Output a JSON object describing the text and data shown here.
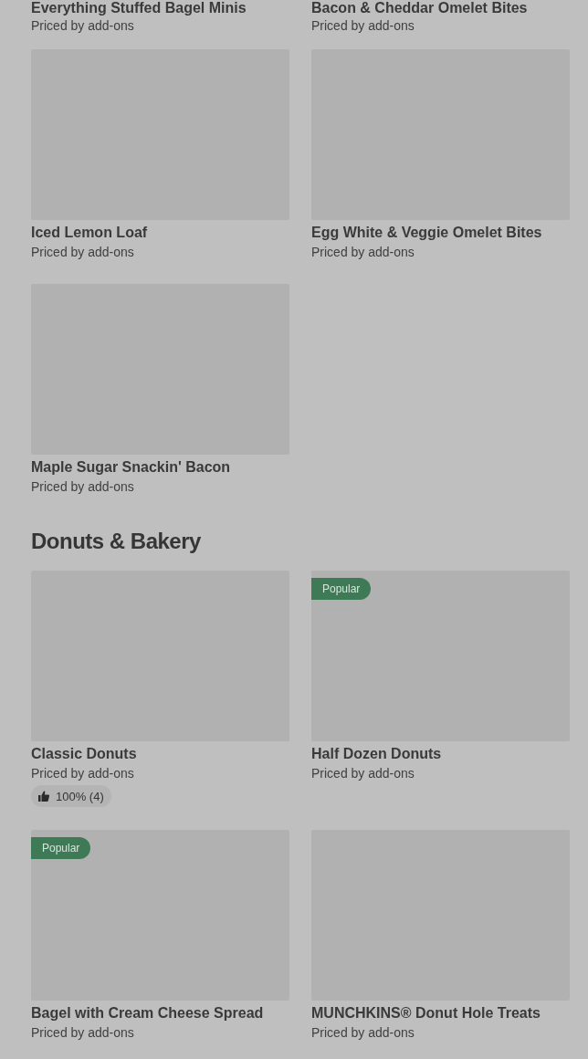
{
  "sections": [
    {
      "top_items": [
        {
          "name": "Everything Stuffed Bagel Minis",
          "price": "Priced by add-ons"
        },
        {
          "name": "Bacon & Cheddar Omelet Bites",
          "price": "Priced by add-ons"
        }
      ],
      "items": [
        {
          "name": "Iced Lemon Loaf",
          "price": "Priced by add-ons"
        },
        {
          "name": "Egg White & Veggie Omelet Bites",
          "price": "Priced by add-ons"
        },
        {
          "name": "Maple Sugar Snackin' Bacon",
          "price": "Priced by add-ons"
        }
      ]
    },
    {
      "title": "Donuts & Bakery",
      "items": [
        {
          "name": "Classic Donuts",
          "price": "Priced by add-ons",
          "rating": "100% (4)"
        },
        {
          "name": "Half Dozen Donuts",
          "price": "Priced by add-ons",
          "badge": "Popular"
        },
        {
          "name": "Bagel with Cream Cheese Spread",
          "price": "Priced by add-ons",
          "badge": "Popular"
        },
        {
          "name": "MUNCHKINS® Donut Hole Treats",
          "price": "Priced by add-ons"
        }
      ]
    }
  ]
}
